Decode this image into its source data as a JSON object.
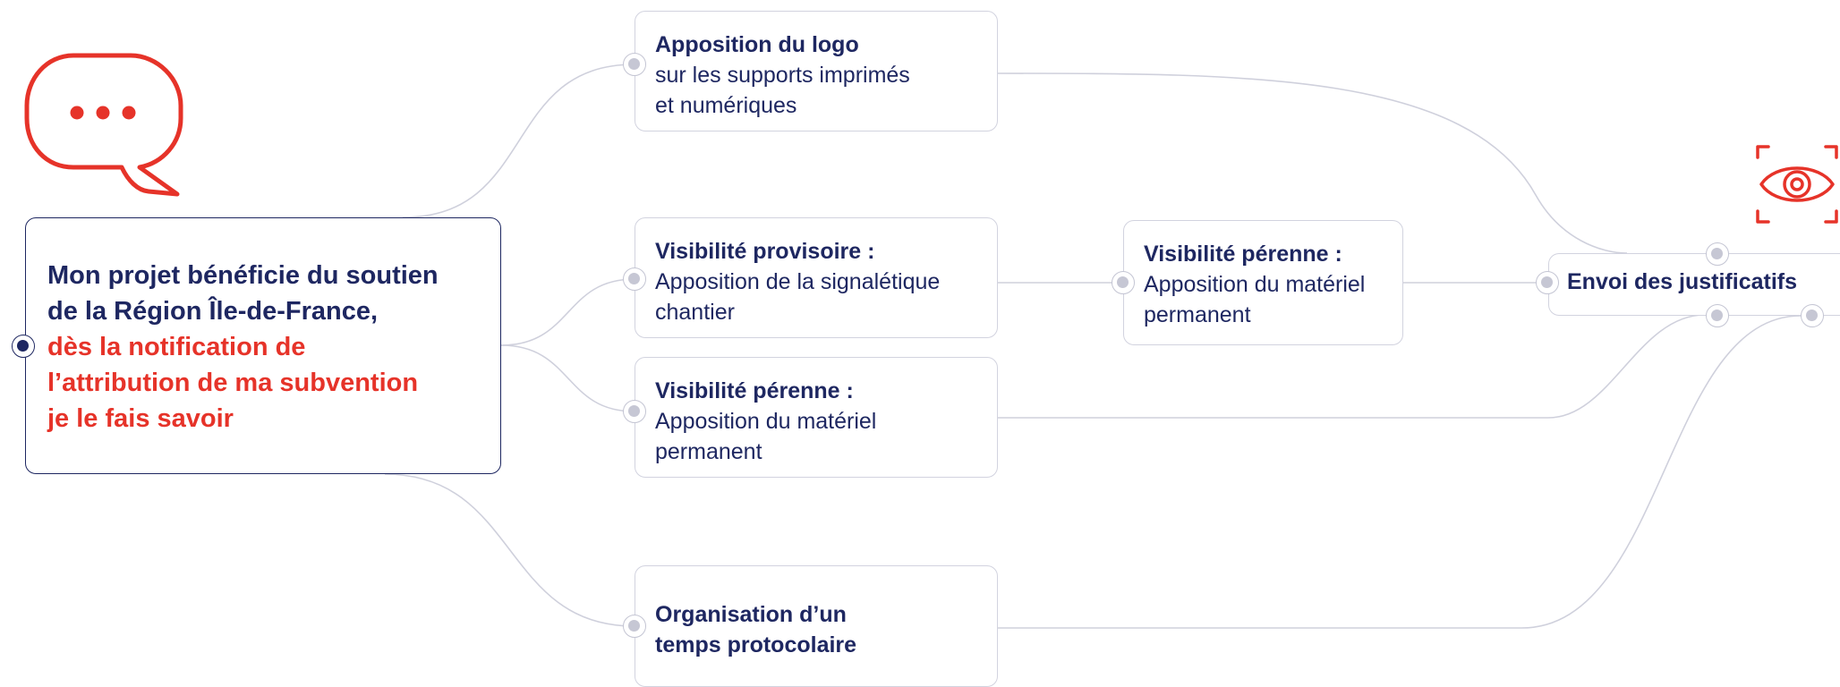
{
  "main": {
    "line1": "Mon projet bénéficie du soutien",
    "line2": "de la Région Île-de-France,",
    "line3": "dès la notification de",
    "line4": "l’attribution de ma subvention",
    "line5": "je le fais savoir"
  },
  "nodes": {
    "logo": {
      "title": "Apposition du logo",
      "line1": "sur les supports imprimés",
      "line2": "et numériques"
    },
    "provisoire": {
      "title": "Visibilité provisoire :",
      "line1": "Apposition de la signalétique",
      "line2": "chantier"
    },
    "perenne_left": {
      "title": "Visibilité pérenne :",
      "line1": "Apposition du matériel",
      "line2": "permanent"
    },
    "perenne_mid": {
      "title": "Visibilité pérenne :",
      "line1": "Apposition du matériel",
      "line2": "permanent"
    },
    "protocole": {
      "line1": "Organisation d’un",
      "line2": "temps protocolaire"
    },
    "envoi": {
      "title": "Envoi des justificatifs"
    }
  },
  "colors": {
    "navy": "#1e2761",
    "red": "#e63329",
    "connector": "#cfd0dc"
  },
  "icons": {
    "top_left": "speech-bubble-icon",
    "top_right": "eye-icon"
  }
}
